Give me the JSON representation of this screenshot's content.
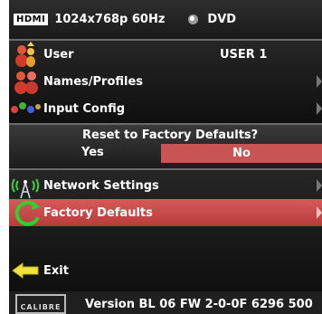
{
  "header": {
    "hdmi_badge": "HDMI",
    "resolution": "1024x768p 60Hz",
    "source": "DVD"
  },
  "menu": {
    "items": [
      {
        "label": "User",
        "value": "USER 1",
        "icon": "user-icon"
      },
      {
        "label": "Names/Profiles",
        "icon": "profiles-icon"
      },
      {
        "label": "Input Config",
        "icon": "input-config-icon"
      }
    ],
    "items2": [
      {
        "label": "Network Settings",
        "icon": "network-antenna-icon"
      },
      {
        "label": "Factory Defaults",
        "icon": "factory-defaults-icon",
        "selected": true
      }
    ],
    "exit_label": "Exit"
  },
  "dialog": {
    "question": "Reset to Factory Defaults?",
    "yes_label": "Yes",
    "no_label": "No",
    "selected": "No"
  },
  "footer": {
    "logo_text": "CALIBRE",
    "version": "Version BL 06 FW 2-0-0F 6296 500"
  },
  "colors": {
    "selected_row": "#c94a4a",
    "background": "#000000"
  }
}
